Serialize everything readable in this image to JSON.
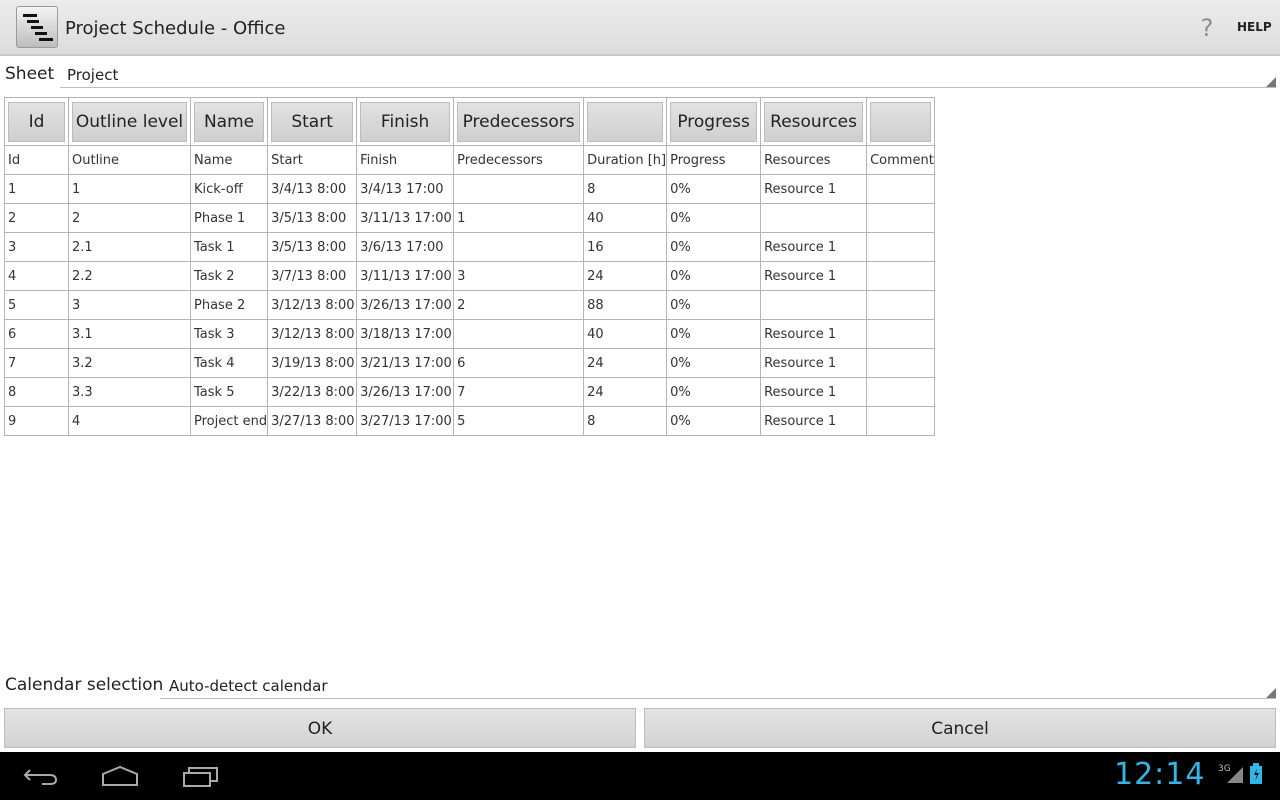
{
  "titlebar": {
    "app_icon": "gantt-icon",
    "title": "Project Schedule - Office",
    "help_icon": "question-icon",
    "help_label": "HELP"
  },
  "sheet": {
    "label": "Sheet",
    "value": "Project"
  },
  "table": {
    "column_buttons": [
      "Id",
      "Outline level",
      "Name",
      "Start",
      "Finish",
      "Predecessors",
      "",
      "Progress",
      "Resources",
      ""
    ],
    "headers": [
      "Id",
      "Outline",
      "Name",
      "Start",
      "Finish",
      "Predecessors",
      "Duration [h]",
      "Progress",
      "Resources",
      "Comment"
    ],
    "rows": [
      [
        "1",
        "1",
        "Kick-off",
        "3/4/13 8:00",
        "3/4/13 17:00",
        "",
        "8",
        "0%",
        "Resource 1",
        ""
      ],
      [
        "2",
        "2",
        "Phase 1",
        "3/5/13 8:00",
        "3/11/13 17:00",
        "1",
        "40",
        "0%",
        "",
        ""
      ],
      [
        "3",
        "2.1",
        "Task 1",
        "3/5/13 8:00",
        "3/6/13 17:00",
        "",
        "16",
        "0%",
        "Resource 1",
        ""
      ],
      [
        "4",
        "2.2",
        "Task 2",
        "3/7/13 8:00",
        "3/11/13 17:00",
        "3",
        "24",
        "0%",
        "Resource 1",
        ""
      ],
      [
        "5",
        "3",
        "Phase 2",
        "3/12/13 8:00",
        "3/26/13 17:00",
        "2",
        "88",
        "0%",
        "",
        ""
      ],
      [
        "6",
        "3.1",
        "Task 3",
        "3/12/13 8:00",
        "3/18/13 17:00",
        "",
        "40",
        "0%",
        "Resource 1",
        ""
      ],
      [
        "7",
        "3.2",
        "Task 4",
        "3/19/13 8:00",
        "3/21/13 17:00",
        "6",
        "24",
        "0%",
        "Resource 1",
        ""
      ],
      [
        "8",
        "3.3",
        "Task 5",
        "3/22/13 8:00",
        "3/26/13 17:00",
        "7",
        "24",
        "0%",
        "Resource 1",
        ""
      ],
      [
        "9",
        "4",
        "Project end",
        "3/27/13 8:00",
        "3/27/13 17:00",
        "5",
        "8",
        "0%",
        "Resource 1",
        ""
      ]
    ]
  },
  "calendar": {
    "label": "Calendar selection",
    "value": "Auto-detect calendar"
  },
  "buttons": {
    "ok": "OK",
    "cancel": "Cancel"
  },
  "statusbar": {
    "clock": "12:14",
    "network": "3G",
    "icons": [
      "back-icon",
      "home-icon",
      "recent-apps-icon",
      "signal-icon",
      "battery-icon"
    ]
  }
}
